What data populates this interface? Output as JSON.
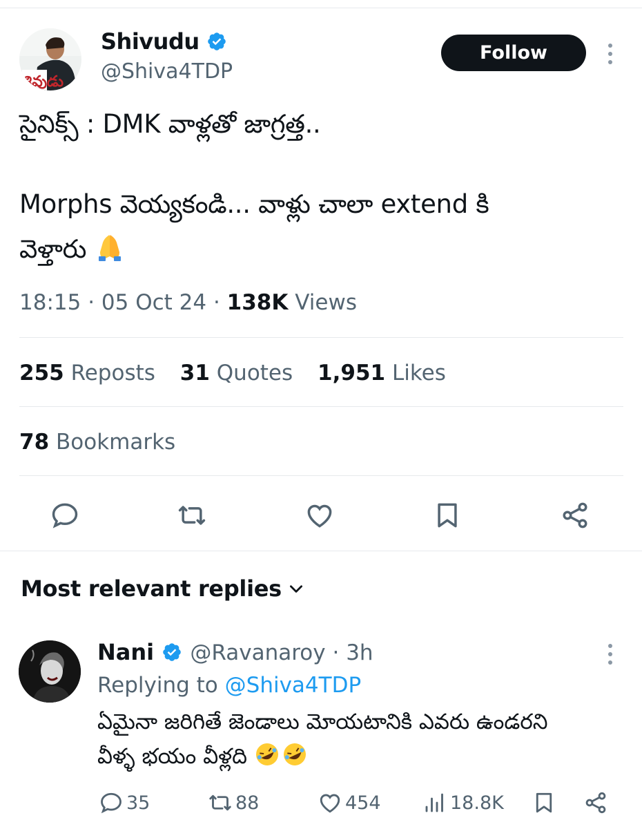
{
  "tweet": {
    "author_name": "Shivudu",
    "author_handle": "@Shiva4TDP",
    "follow_label": "Follow",
    "text_line1": "సైనిక్స్ : DMK వాళ్లతో జాగ్రత్త..",
    "text_line2": " Morphs వెయ్యకండి...  వాళ్లు చాలా extend కి",
    "text_line3": "వెళ్తారు",
    "text_emoji": "🙏",
    "time": "18:15",
    "date": "05 Oct 24",
    "views_count": "138K",
    "views_label": "Views",
    "stats": {
      "reposts_count": "255",
      "reposts_label": "Reposts",
      "quotes_count": "31",
      "quotes_label": "Quotes",
      "likes_count": "1,951",
      "likes_label": "Likes",
      "bookmarks_count": "78",
      "bookmarks_label": "Bookmarks"
    },
    "actions": [
      "reply-icon",
      "repost-icon",
      "like-icon",
      "bookmark-icon",
      "share-icon"
    ]
  },
  "replies": {
    "heading": "Most relevant replies",
    "items": [
      {
        "name": "Nani",
        "handle": "@Ravanaroy",
        "age": "3h",
        "replying_prefix": "Replying to",
        "replying_to": "@Shiva4TDP",
        "text_line1": "ఏమైనా జరిగితే జెండాలు మోయటానికి ఎవరు ఉండరని",
        "text_line2": "వీళ్ళ భయం వీళ్లది",
        "text_emoji": "🤣🤣",
        "reply_count": "35",
        "repost_count": "88",
        "like_count": "454",
        "view_count": "18.8K"
      }
    ]
  },
  "colors": {
    "text": "#0f1419",
    "secondary": "#536471",
    "accent": "#1d9bf0",
    "divider": "#e6e9ec",
    "follow_bg": "#0f1419"
  }
}
